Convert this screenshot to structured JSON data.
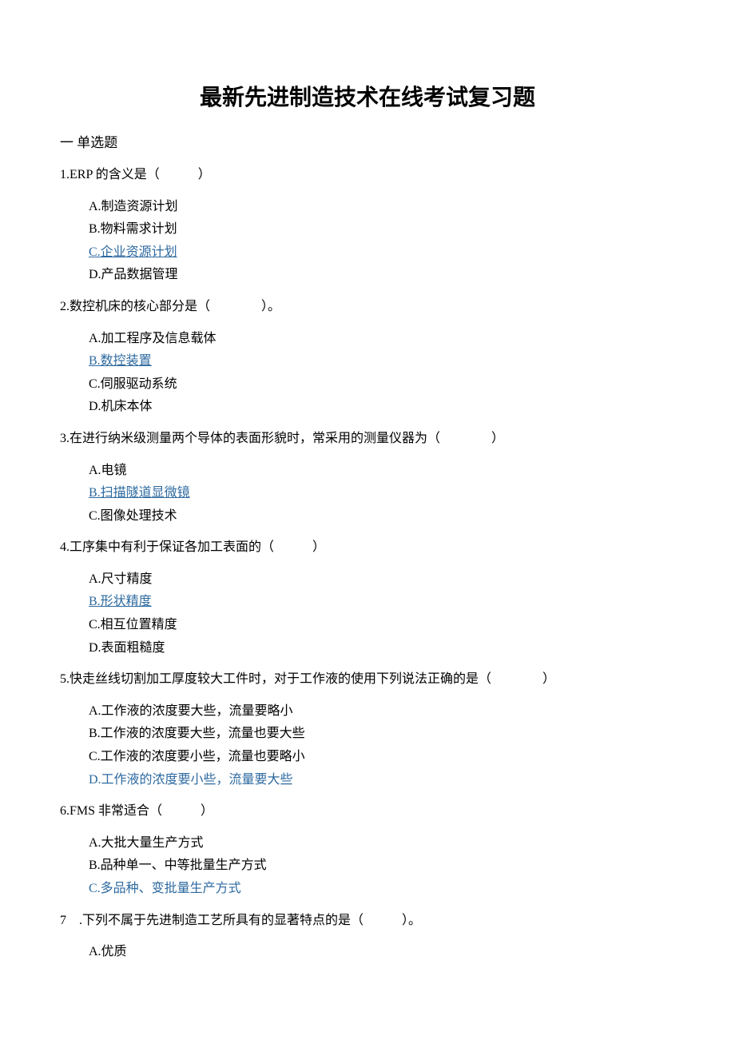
{
  "title": "最新先进制造技术在线考试复习题",
  "section_heading": "一 单选题",
  "questions": [
    {
      "stem": "1.ERP 的含义是（　　　）",
      "options": [
        {
          "text": "A.制造资源计划",
          "is_answer": false
        },
        {
          "text": "B.物料需求计划",
          "is_answer": false
        },
        {
          "text": "C.企业资源计划",
          "is_answer": true
        },
        {
          "text": "D.产品数据管理",
          "is_answer": false
        }
      ]
    },
    {
      "stem": "2.数控机床的核心部分是（　　　　）。",
      "options": [
        {
          "text": "A.加工程序及信息载体",
          "is_answer": false
        },
        {
          "text": "B.数控装置",
          "is_answer": true
        },
        {
          "text": "C.伺服驱动系统",
          "is_answer": false
        },
        {
          "text": "D.机床本体",
          "is_answer": false
        }
      ]
    },
    {
      "stem": "3.在进行纳米级测量两个导体的表面形貌时，常采用的测量仪器为（　　　　）",
      "options": [
        {
          "text": "A.电镜",
          "is_answer": false
        },
        {
          "text": "B.扫描隧道显微镜",
          "is_answer": true
        },
        {
          "text": "C.图像处理技术",
          "is_answer": false
        }
      ]
    },
    {
      "stem": "4.工序集中有利于保证各加工表面的（　　　）",
      "options": [
        {
          "text": "A.尺寸精度",
          "is_answer": false
        },
        {
          "text": "B.形状精度",
          "is_answer": true
        },
        {
          "text": "C.相互位置精度",
          "is_answer": false
        },
        {
          "text": "D.表面粗糙度",
          "is_answer": false
        }
      ]
    },
    {
      "stem": "5.快走丝线切割加工厚度较大工件时，对于工作液的使用下列说法正确的是（　　　　）",
      "options": [
        {
          "text": "A.工作液的浓度要大些，流量要略小",
          "is_answer": false
        },
        {
          "text": "B.工作液的浓度要大些，流量也要大些",
          "is_answer": false
        },
        {
          "text": "C.工作液的浓度要小些，流量也要略小",
          "is_answer": false
        },
        {
          "text": "D.工作液的浓度要小些，流量要大些",
          "is_answer": true,
          "no_underline": true
        }
      ]
    },
    {
      "stem": "6.FMS 非常适合（　　　）",
      "options": [
        {
          "text": "A.大批大量生产方式",
          "is_answer": false
        },
        {
          "text": "B.品种单一、中等批量生产方式",
          "is_answer": false
        },
        {
          "text": "C.多品种、变批量生产方式",
          "is_answer": true,
          "no_underline": true
        }
      ]
    },
    {
      "stem": "7　.下列不属于先进制造工艺所具有的显著特点的是（　　　）。",
      "options": [
        {
          "text": "A.优质",
          "is_answer": false
        }
      ]
    }
  ]
}
